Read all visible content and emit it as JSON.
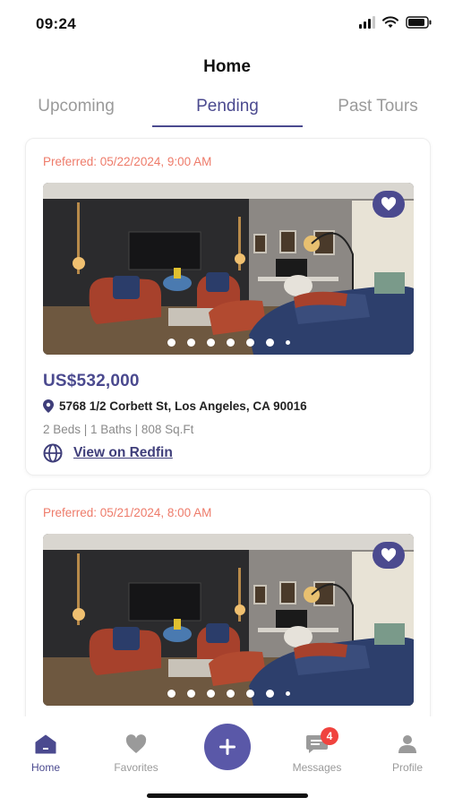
{
  "status_bar": {
    "time": "09:24"
  },
  "header": {
    "title": "Home"
  },
  "tabs": [
    {
      "label": "Upcoming",
      "active": false
    },
    {
      "label": "Pending",
      "active": true
    },
    {
      "label": "Past Tours",
      "active": false
    }
  ],
  "listings": [
    {
      "preferred": "Preferred: 05/22/2024, 9:00 AM",
      "price": "US$532,000",
      "address": "5768 1/2 Corbett St, Los Angeles, CA 90016",
      "details": "2 Beds | 1 Baths | 808 Sq.Ft",
      "link_label": "View on Redfin",
      "favorited": true
    },
    {
      "preferred": "Preferred: 05/21/2024, 8:00 AM",
      "favorited": true
    }
  ],
  "bottom_nav": [
    {
      "label": "Home",
      "icon": "home-icon",
      "active": true
    },
    {
      "label": "Favorites",
      "icon": "heart-icon",
      "active": false
    },
    {
      "label": "",
      "icon": "plus-icon",
      "active": false
    },
    {
      "label": "Messages",
      "icon": "message-icon",
      "active": false,
      "badge": "4"
    },
    {
      "label": "Profile",
      "icon": "profile-icon",
      "active": false
    }
  ],
  "colors": {
    "accent": "#4b4a8f",
    "preferred": "#ee7b6a",
    "badge": "#f0433e"
  }
}
